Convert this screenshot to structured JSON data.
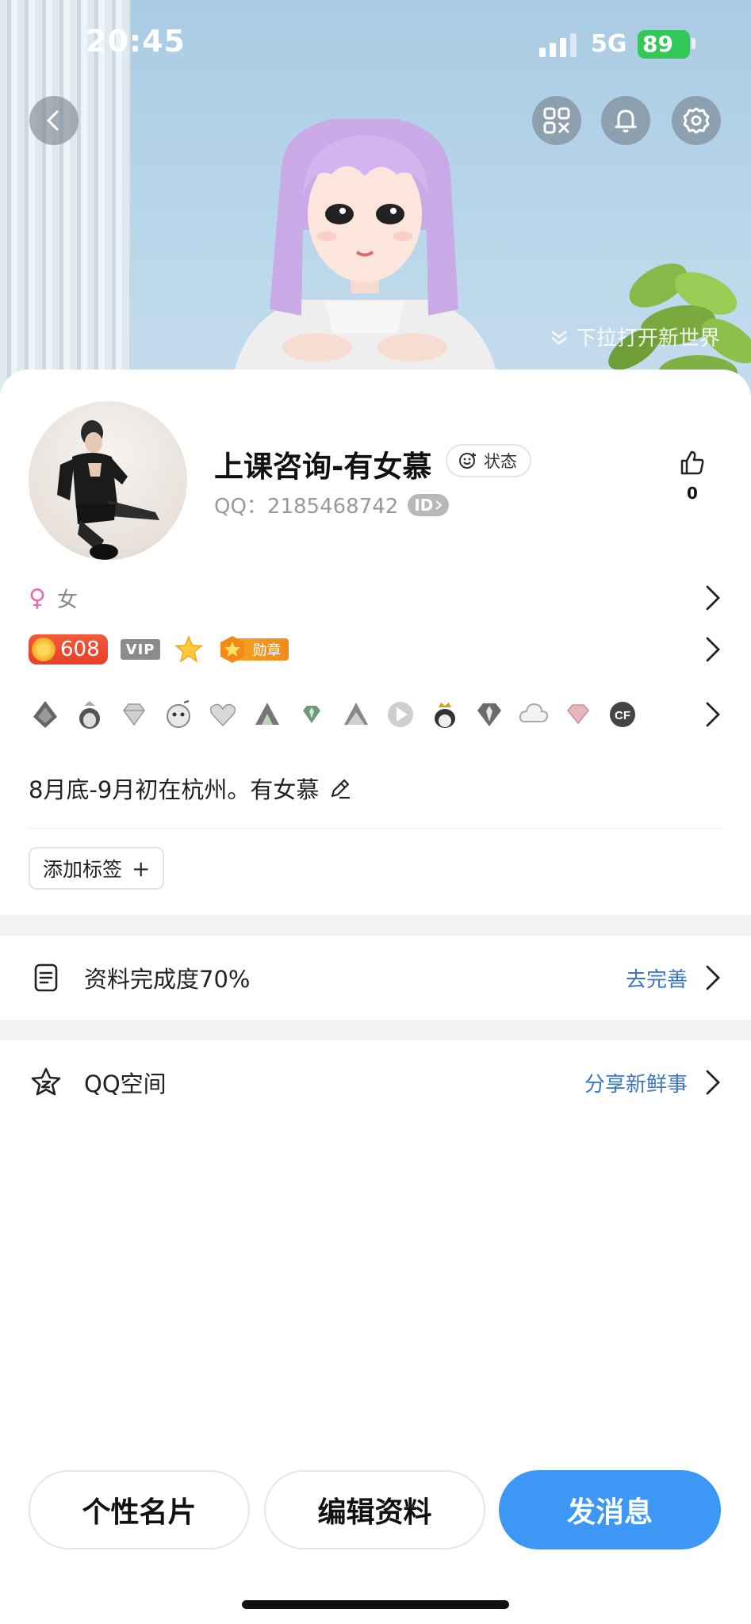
{
  "status_bar": {
    "time": "20:45",
    "network": "5G",
    "battery": "89"
  },
  "header": {
    "pull_hint": "下拉打开新世界",
    "icons": [
      "back-icon",
      "qr-code-icon",
      "bell-icon",
      "gear-icon"
    ]
  },
  "profile": {
    "nickname": "上课咨询-有女慕",
    "status_label": "状态",
    "qq_label": "QQ：2185468742",
    "id_badge": "ID",
    "likes": "0",
    "gender": "女",
    "gender_symbol": "♀",
    "coin_value": "608",
    "vip_label": "VIP",
    "medal_label": "勋章",
    "signature": "8月底-9月初在杭州。有女慕",
    "add_tag_label": "添加标签",
    "add_tag_plus": "+"
  },
  "game_icons": [
    "game-icon-1",
    "game-icon-2",
    "diamond-icon",
    "game-icon-4",
    "heart-icon",
    "game-icon-6",
    "diamond-icon-green",
    "game-icon-8",
    "play-icon",
    "penguin-crown-icon",
    "diamond-icon-dark",
    "cloud-icon",
    "diamond-icon-pink",
    "cf-icon"
  ],
  "completion": {
    "label": "资料完成度70%",
    "action": "去完善",
    "percent": 70
  },
  "qzone": {
    "label": "QQ空间",
    "action": "分享新鲜事"
  },
  "bottom": {
    "card_label": "个性名片",
    "edit_label": "编辑资料",
    "message_label": "发消息"
  },
  "colors": {
    "primary": "#3d97f5",
    "link": "#3b76c7",
    "coin": "#e8402a",
    "battery": "#34c759"
  }
}
